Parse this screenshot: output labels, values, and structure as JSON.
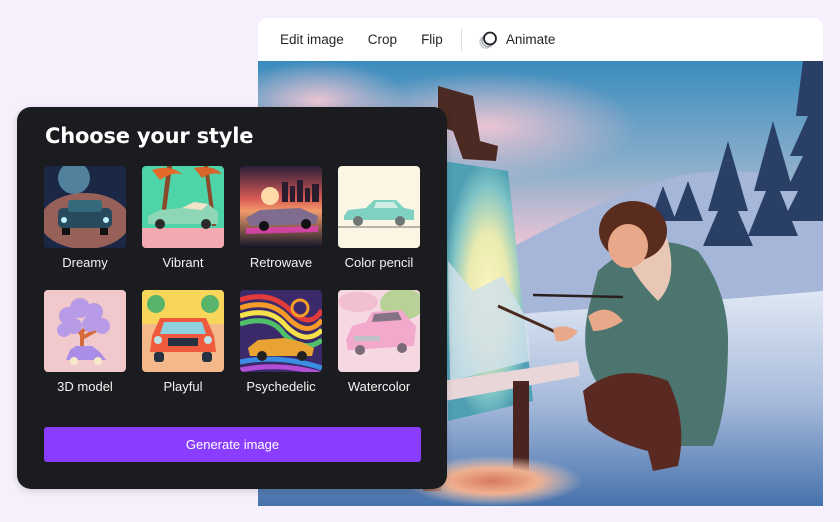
{
  "toolbar": {
    "items": [
      {
        "label": "Edit image"
      },
      {
        "label": "Crop"
      },
      {
        "label": "Flip"
      }
    ],
    "animate": {
      "label": "Animate",
      "icon": "animate-circles-icon"
    }
  },
  "canvas": {
    "image_description": "Woman in green coat crouching in snow painting on an easel, winter mountains and pine trees"
  },
  "panel": {
    "title": "Choose your style",
    "styles": [
      {
        "label": "Dreamy"
      },
      {
        "label": "Vibrant"
      },
      {
        "label": "Retrowave"
      },
      {
        "label": "Color pencil"
      },
      {
        "label": "3D model"
      },
      {
        "label": "Playful"
      },
      {
        "label": "Psychedelic"
      },
      {
        "label": "Watercolor"
      }
    ],
    "generate_label": "Generate image"
  },
  "colors": {
    "accent": "#8b3dff",
    "panel_bg": "#1b1c1f",
    "page_bg": "#f6f0fd"
  }
}
